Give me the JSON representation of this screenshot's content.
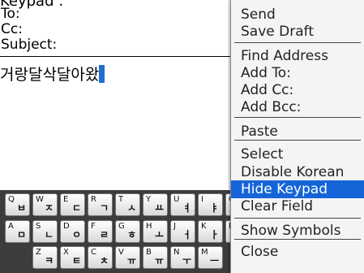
{
  "top_text": "Keypad",
  "compose": {
    "to_label": "To:",
    "cc_label": "Cc:",
    "subject_label": "Subject:",
    "body_text": "거랑달삭달아왔"
  },
  "keyboard": {
    "rows": [
      [
        {
          "lat": "Q",
          "kor": "ㅂ"
        },
        {
          "lat": "W",
          "kor": "ㅈ"
        },
        {
          "lat": "E",
          "kor": "ㄷ"
        },
        {
          "lat": "R",
          "kor": "ㄱ"
        },
        {
          "lat": "T",
          "kor": "ㅅ"
        },
        {
          "lat": "Y",
          "kor": "ㅛ"
        },
        {
          "lat": "U",
          "kor": "ㅕ"
        },
        {
          "lat": "I",
          "kor": "ㅑ"
        },
        {
          "lat": "O",
          "kor": "ㅐ"
        }
      ],
      [
        {
          "lat": "A",
          "kor": "ㅁ"
        },
        {
          "lat": "S",
          "kor": "ㄴ"
        },
        {
          "lat": "D",
          "kor": "ㅇ"
        },
        {
          "lat": "F",
          "kor": "ㄹ"
        },
        {
          "lat": "G",
          "kor": "ㅎ"
        },
        {
          "lat": "H",
          "kor": "ㅗ"
        },
        {
          "lat": "J",
          "kor": "ㅓ"
        },
        {
          "lat": "K",
          "kor": "ㅏ"
        },
        {
          "lat": "L",
          "kor": "ㅣ"
        }
      ],
      [
        {
          "lat": "Z",
          "kor": "ㅋ"
        },
        {
          "lat": "X",
          "kor": "ㅌ"
        },
        {
          "lat": "C",
          "kor": "ㅊ"
        },
        {
          "lat": "V",
          "kor": "ㅠ"
        },
        {
          "lat": "B",
          "kor": "ㅠ"
        },
        {
          "lat": "N",
          "kor": "ㅜ"
        },
        {
          "lat": "M",
          "kor": "ㅡ"
        }
      ]
    ]
  },
  "menu": {
    "items": [
      "Send",
      "Save Draft",
      "Find Address",
      "Add To:",
      "Add Cc:",
      "Add Bcc:",
      "Paste",
      "Select",
      "Disable Korean",
      "Hide Keypad",
      "Clear Field",
      "Show Symbols",
      "Close"
    ],
    "selected": "Hide Keypad"
  },
  "colors": {
    "selection": "#1565d8",
    "cursor": "#1f6fd0",
    "keyboard_bg": "#3c3c3c"
  }
}
